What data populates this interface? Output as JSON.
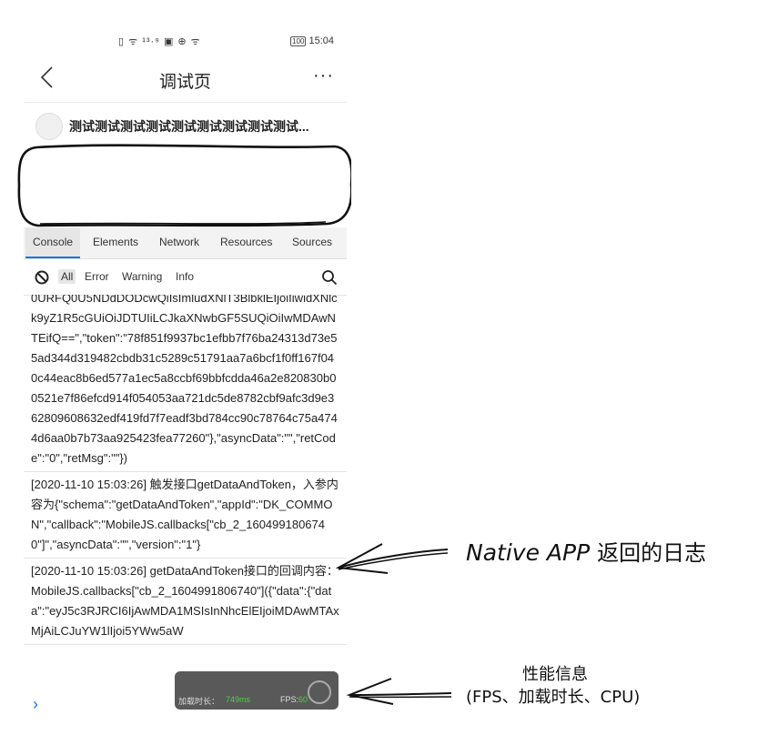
{
  "status_bar": {
    "icons": "▯ ᯤ ¹³·⁹ ▣ ⊕ ᯤ",
    "time": "15:04",
    "battery": "100"
  },
  "nav": {
    "title": "调试页",
    "more": "···"
  },
  "header": {
    "title": "测试测试测试测试测试测试测试测试测试..."
  },
  "devtools": {
    "tabs": [
      "Console",
      "Elements",
      "Network",
      "Resources",
      "Sources"
    ],
    "levels": [
      "All",
      "Error",
      "Warning",
      "Info"
    ]
  },
  "logs": [
    "0URFQ0U5NDdDODcwQiIsImludXNlT3BlbklEIjoiIiwidXNlck9yZ1R5cGUiOiJDTUIiLCJkaXNwbGF5SUQiOiIwMDAwNTEifQ==\",\"token\":\"78f851f9937bc1efbb7f76ba24313d73e55ad344d319482cbdb31c5289c51791aa7a6bcf1f0ff167f040c44eac8b6ed577a1ec5a8ccbf69bbfcdda46a2e820830b00521e7f86efcd914f054053aa721dc5de8782cbf9afc3d9e362809608632edf419fd7f7eadf3bd784cc90c78764c75a4744d6aa0b7b73aa925423fea77260\"},\"asyncData\":\"\",\"retCode\":\"0\",\"retMsg\":\"\"})",
    "[2020-11-10 15:03:26] 触发接口getDataAndToken，入参内容为{\"schema\":\"getDataAndToken\",\"appId\":\"DK_COMMON\",\"callback\":\"MobileJS.callbacks[\"cb_2_1604991806740\"]\",\"asyncData\":\"\",\"version\":\"1\"}",
    "[2020-11-10 15:03:26] getDataAndToken接口的回调内容：MobileJS.callbacks[\"cb_2_1604991806740\"]({\"data\":{\"data\":\"eyJ5c3RJRCI6IjAwMDA1MSIsInNhcElEIjoiMDAwMTAxMjAiLCJuYW1lIjoi5YWw5aW"
  ],
  "perf": {
    "load_label": "加载时长：",
    "load_value": "749ms",
    "fps_label": "FPS:",
    "fps_value": "60"
  },
  "annotations": {
    "native_latin": "Native APP",
    "native_cn": "返回的日志",
    "perf_line1": "性能信息",
    "perf_line2": "(FPS、加载时长、CPU)"
  }
}
